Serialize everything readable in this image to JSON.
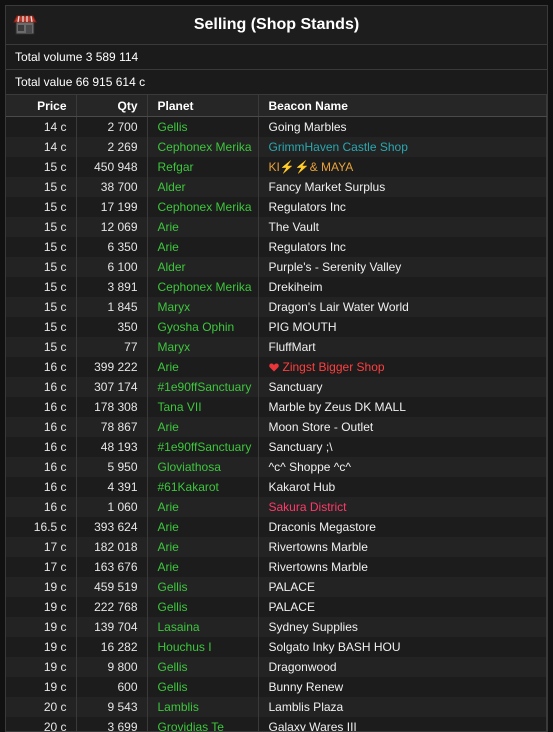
{
  "window": {
    "title": "Selling (Shop Stands)",
    "total_volume": "Total volume 3 589 114",
    "total_value": "Total value 66 915 614 c"
  },
  "colors": {
    "planet": "#3cc73c",
    "teal": "#2aa8b0",
    "orange": "#e9a13a",
    "red": "#ff3f3f",
    "pink": "#ff3a6a"
  },
  "table": {
    "columns": [
      "Price",
      "Qty",
      "Planet",
      "Beacon Name"
    ],
    "rows": [
      {
        "price": "14 c",
        "qty": "2 700",
        "planet": "Gellis",
        "beacon": "Going Marbles"
      },
      {
        "price": "14 c",
        "qty": "2 269",
        "planet": "Cephonex Merika",
        "beacon": "GrimmHaven Castle Shop",
        "beacon_color": "teal"
      },
      {
        "price": "15 c",
        "qty": "450 948",
        "planet": "Refgar",
        "beacon": "KI⚡⚡& MAYA",
        "beacon_color": "orange"
      },
      {
        "price": "15 c",
        "qty": "38 700",
        "planet": "Alder",
        "beacon": "Fancy Market Surplus"
      },
      {
        "price": "15 c",
        "qty": "17 199",
        "planet": "Cephonex Merika",
        "beacon": "Regulators Inc"
      },
      {
        "price": "15 c",
        "qty": "12 069",
        "planet": "Arie",
        "beacon": "The Vault"
      },
      {
        "price": "15 c",
        "qty": "6 350",
        "planet": "Arie",
        "beacon": "Regulators Inc"
      },
      {
        "price": "15 c",
        "qty": "6 100",
        "planet": "Alder",
        "beacon": "Purple's - Serenity Valley"
      },
      {
        "price": "15 c",
        "qty": "3 891",
        "planet": "Cephonex Merika",
        "beacon": "Drekiheim"
      },
      {
        "price": "15 c",
        "qty": "1 845",
        "planet": "Maryx",
        "beacon": "Dragon's Lair Water World"
      },
      {
        "price": "15 c",
        "qty": "350",
        "planet": "Gyosha Ophin",
        "beacon": "PIG MOUTH"
      },
      {
        "price": "15 c",
        "qty": "77",
        "planet": "Maryx",
        "beacon": "FluffMart"
      },
      {
        "price": "16 c",
        "qty": "399 222",
        "planet": "Arie",
        "beacon": "Zingst Bigger Shop",
        "beacon_color": "red",
        "beacon_icon": "heart-icon"
      },
      {
        "price": "16 c",
        "qty": "307 174",
        "planet": "#1e90ffSanctuary",
        "beacon": "Sanctuary"
      },
      {
        "price": "16 c",
        "qty": "178 308",
        "planet": "Tana VII",
        "beacon": "Marble by Zeus DK MALL"
      },
      {
        "price": "16 c",
        "qty": "78 867",
        "planet": "Arie",
        "beacon": "Moon Store - Outlet"
      },
      {
        "price": "16 c",
        "qty": "48 193",
        "planet": "#1e90ffSanctuary",
        "beacon": "Sanctuary ;\\"
      },
      {
        "price": "16 c",
        "qty": "5 950",
        "planet": "Gloviathosa",
        "beacon": "^c^ Shoppe ^c^"
      },
      {
        "price": "16 c",
        "qty": "4 391",
        "planet": "#61Kakarot",
        "beacon": "Kakarot Hub"
      },
      {
        "price": "16 c",
        "qty": "1 060",
        "planet": "Arie",
        "beacon": "Sakura District",
        "beacon_color": "pink"
      },
      {
        "price": "16.5 c",
        "qty": "393 624",
        "planet": "Arie",
        "beacon": "Draconis Megastore"
      },
      {
        "price": "17 c",
        "qty": "182 018",
        "planet": "Arie",
        "beacon": "Rivertowns Marble"
      },
      {
        "price": "17 c",
        "qty": "163 676",
        "planet": "Arie",
        "beacon": "Rivertowns Marble"
      },
      {
        "price": "19 c",
        "qty": "459 519",
        "planet": "Gellis",
        "beacon": "PALACE"
      },
      {
        "price": "19 c",
        "qty": "222 768",
        "planet": "Gellis",
        "beacon": "PALACE"
      },
      {
        "price": "19 c",
        "qty": "139 704",
        "planet": "Lasaina",
        "beacon": "Sydney Supplies"
      },
      {
        "price": "19 c",
        "qty": "16 282",
        "planet": "Houchus I",
        "beacon": "Solgato Inky BASH HOU"
      },
      {
        "price": "19 c",
        "qty": "9 800",
        "planet": "Gellis",
        "beacon": "Dragonwood"
      },
      {
        "price": "19 c",
        "qty": "600",
        "planet": "Gellis",
        "beacon": "Bunny Renew"
      },
      {
        "price": "20 c",
        "qty": "9 543",
        "planet": "Lamblis",
        "beacon": "Lamblis Plaza"
      },
      {
        "price": "20 c",
        "qty": "3 699",
        "planet": "Grovidias Te",
        "beacon": "Galaxy Wares III"
      }
    ]
  }
}
